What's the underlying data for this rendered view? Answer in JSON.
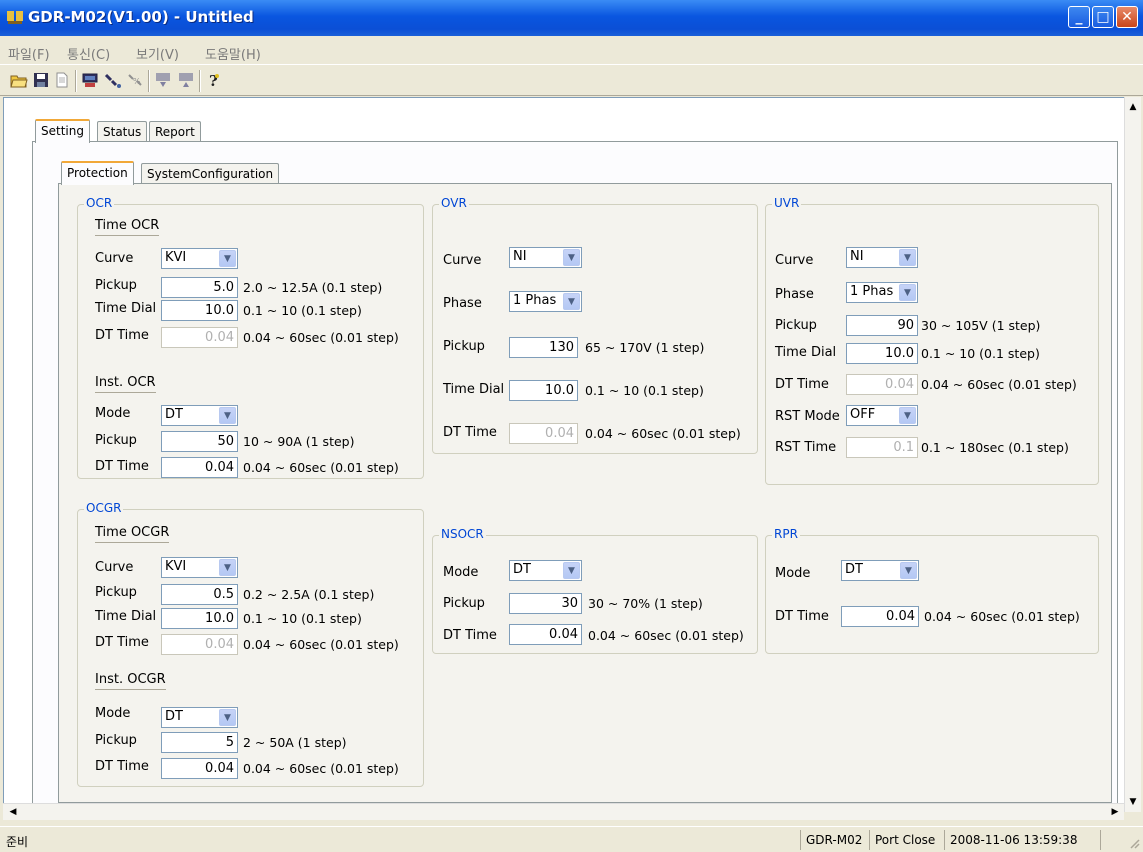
{
  "window": {
    "title": "GDR-M02(V1.00) - Untitled"
  },
  "menu": [
    "파일(F)",
    "통신(C)",
    "보기(V)",
    "도움말(H)"
  ],
  "toolbar": [
    "open-icon",
    "save-icon",
    "document-icon",
    "connect-icon",
    "link-icon",
    "unlink-icon",
    "download-icon",
    "upload-icon",
    "help-icon"
  ],
  "tabs": {
    "outer": [
      "Setting",
      "Status",
      "Report"
    ],
    "outer_active": "Setting",
    "inner": [
      "Protection",
      "SystemConfiguration"
    ],
    "inner_active": "Protection"
  },
  "ocr": {
    "title": "OCR",
    "time_title": "Time OCR",
    "curve_label": "Curve",
    "curve_value": "KVI",
    "pickup_label": "Pickup",
    "pickup_value": "5.0",
    "pickup_range": "2.0 ~ 12.5A (0.1 step)",
    "td_label": "Time Dial",
    "td_value": "10.0",
    "td_range": "0.1 ~ 10 (0.1 step)",
    "dt_label": "DT Time",
    "dt_value": "0.04",
    "dt_range": "0.04 ~ 60sec (0.01 step)",
    "inst_title": "Inst. OCR",
    "mode_label": "Mode",
    "mode_value": "DT",
    "ipickup_label": "Pickup",
    "ipickup_value": "50",
    "ipickup_range": "10 ~ 90A (1 step)",
    "idt_label": "DT Time",
    "idt_value": "0.04",
    "idt_range": "0.04 ~ 60sec (0.01 step)"
  },
  "ocgr": {
    "title": "OCGR",
    "time_title": "Time OCGR",
    "curve_label": "Curve",
    "curve_value": "KVI",
    "pickup_label": "Pickup",
    "pickup_value": "0.5",
    "pickup_range": "0.2 ~ 2.5A (0.1 step)",
    "td_label": "Time Dial",
    "td_value": "10.0",
    "td_range": "0.1 ~ 10 (0.1 step)",
    "dt_label": "DT Time",
    "dt_value": "0.04",
    "dt_range": "0.04 ~ 60sec (0.01 step)",
    "inst_title": "Inst. OCGR",
    "mode_label": "Mode",
    "mode_value": "DT",
    "ipickup_label": "Pickup",
    "ipickup_value": "5",
    "ipickup_range": "2 ~ 50A (1 step)",
    "idt_label": "DT Time",
    "idt_value": "0.04",
    "idt_range": "0.04 ~ 60sec (0.01 step)"
  },
  "ovr": {
    "title": "OVR",
    "curve_label": "Curve",
    "curve_value": "NI",
    "phase_label": "Phase",
    "phase_value": "1 Phas",
    "pickup_label": "Pickup",
    "pickup_value": "130",
    "pickup_range": "65 ~ 170V (1 step)",
    "td_label": "Time Dial",
    "td_value": "10.0",
    "td_range": "0.1 ~ 10 (0.1 step)",
    "dt_label": "DT Time",
    "dt_value": "0.04",
    "dt_range": "0.04 ~ 60sec (0.01 step)"
  },
  "uvr": {
    "title": "UVR",
    "curve_label": "Curve",
    "curve_value": "NI",
    "phase_label": "Phase",
    "phase_value": "1 Phas",
    "pickup_label": "Pickup",
    "pickup_value": "90",
    "pickup_range": "30 ~ 105V (1 step)",
    "td_label": "Time Dial",
    "td_value": "10.0",
    "td_range": "0.1 ~ 10 (0.1 step)",
    "dt_label": "DT Time",
    "dt_value": "0.04",
    "dt_range": "0.04 ~ 60sec (0.01 step)",
    "rstmode_label": "RST Mode",
    "rstmode_value": "OFF",
    "rsttime_label": "RST Time",
    "rsttime_value": "0.1",
    "rsttime_range": "0.1 ~ 180sec (0.1 step)"
  },
  "nsocr": {
    "title": "NSOCR",
    "mode_label": "Mode",
    "mode_value": "DT",
    "pickup_label": "Pickup",
    "pickup_value": "30",
    "pickup_range": "30 ~ 70% (1 step)",
    "dt_label": "DT Time",
    "dt_value": "0.04",
    "dt_range": "0.04 ~ 60sec (0.01 step)"
  },
  "rpr": {
    "title": "RPR",
    "mode_label": "Mode",
    "mode_value": "DT",
    "dt_label": "DT Time",
    "dt_value": "0.04",
    "dt_range": "0.04 ~ 60sec (0.01 step)"
  },
  "status": {
    "ready": "준비",
    "device": "GDR-M02",
    "port": "Port Close",
    "datetime": "2008-11-06 13:59:38"
  },
  "colors": {
    "titlebar": "#0a56e0",
    "group_label": "#0046d5",
    "active_tab": "#f1a838"
  }
}
